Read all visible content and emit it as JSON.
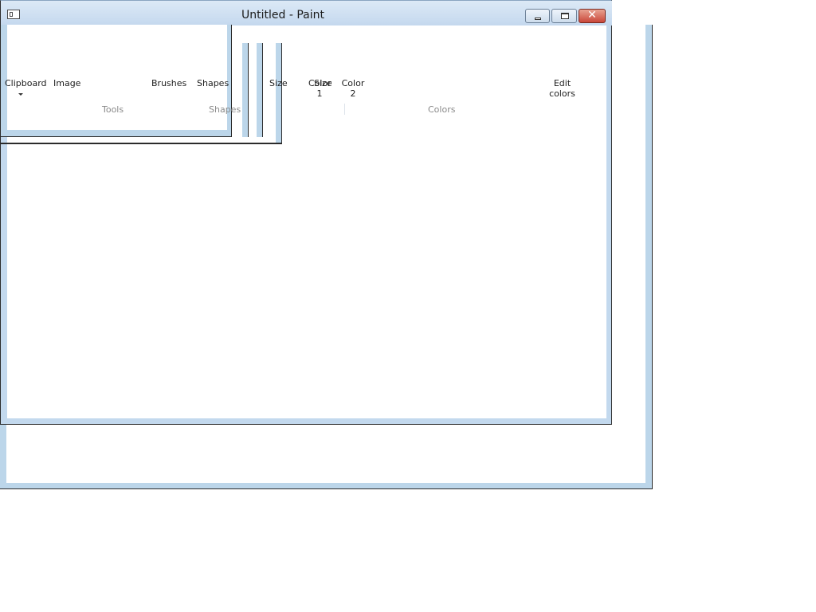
{
  "window": {
    "title": "Untitled - Paint"
  },
  "caption_buttons": {
    "close_glyph": "✕"
  },
  "ribbon": {
    "clipboard_label": "Clipboard",
    "image_label": "Image",
    "brushes_label": "Brushes",
    "shapes_label": "Shapes",
    "size_label": "Size",
    "color1_label": "Color\n1",
    "color2_label": "Color\n2",
    "edit_colors_label": "Edit\ncolors",
    "groups": {
      "tools": "Tools",
      "shapes": "Shapes",
      "colors": "Colors"
    }
  },
  "colors": {
    "frame_blue": "#bcd6ea",
    "border_dark": "#2b2b2b",
    "close_red": "#c9473a"
  }
}
